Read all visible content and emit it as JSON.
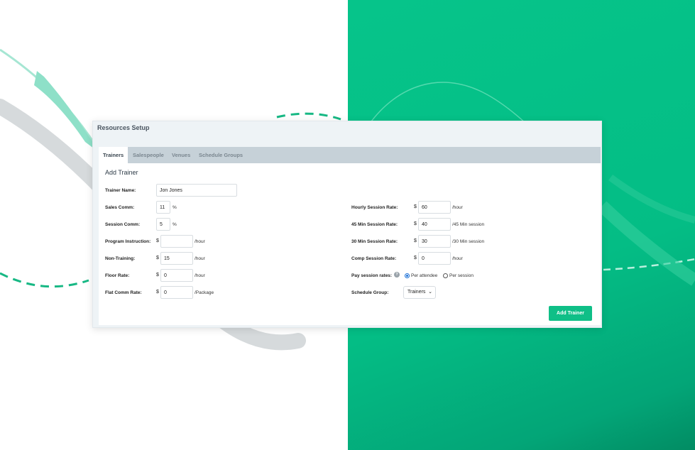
{
  "colors": {
    "accent": "#0fbf87",
    "background_green": "#04bd85",
    "tab_bar": "#c6d1d8"
  },
  "panel": {
    "title": "Resources Setup"
  },
  "tabs": [
    {
      "label": "Trainers",
      "active": true
    },
    {
      "label": "Salespeople",
      "active": false
    },
    {
      "label": "Venues",
      "active": false
    },
    {
      "label": "Schedule Groups",
      "active": false
    }
  ],
  "form": {
    "heading": "Add Trainer",
    "trainer_name": {
      "label": "Trainer Name:",
      "value": "Jon Jones"
    },
    "sales_comm": {
      "label": "Sales Comm:",
      "value": "11",
      "suffix": "%"
    },
    "session_comm": {
      "label": "Session Comm:",
      "value": "5",
      "suffix": "%"
    },
    "program_instruction": {
      "label": "Program Instruction:",
      "currency": "$",
      "value": "",
      "suffix": "/hour"
    },
    "non_training": {
      "label": "Non-Training:",
      "currency": "$",
      "value": "15",
      "suffix": "/hour"
    },
    "floor_rate": {
      "label": "Floor Rate:",
      "currency": "$",
      "value": "0",
      "suffix": "/hour"
    },
    "flat_comm_rate": {
      "label": "Flat Comm Rate:",
      "currency": "$",
      "value": "0",
      "suffix": "/Package"
    },
    "hourly_session_rate": {
      "label": "Hourly Session Rate:",
      "currency": "$",
      "value": "60",
      "suffix": "/hour"
    },
    "min45_session_rate": {
      "label": "45 Min Session Rate:",
      "currency": "$",
      "value": "40",
      "suffix": "/45 Min session"
    },
    "min30_session_rate": {
      "label": "30 Min Session Rate:",
      "currency": "$",
      "value": "30",
      "suffix": "/30 Min session"
    },
    "comp_session_rate": {
      "label": "Comp Session Rate:",
      "currency": "$",
      "value": "0",
      "suffix": "/hour"
    },
    "pay_session_rates": {
      "label": "Pay session rates:",
      "help_icon": "question-icon",
      "options": [
        {
          "label": "Per attendee",
          "checked": true
        },
        {
          "label": "Per session",
          "checked": false
        }
      ]
    },
    "schedule_group": {
      "label": "Schedule Group:",
      "selected": "Trainers",
      "chevron_icon": "chevron-down-icon"
    },
    "submit_label": "Add Trainer"
  }
}
